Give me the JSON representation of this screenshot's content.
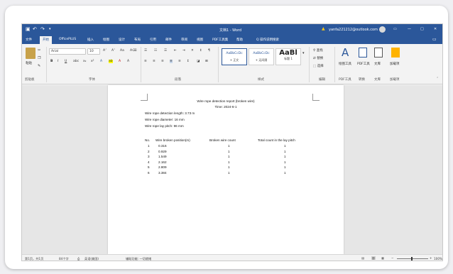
{
  "titlebar": {
    "doc_title": "文档1 - Word",
    "account": "yanfa221212@outlook.com",
    "undo_label": "↶",
    "redo_label": "↷",
    "warn_label": "▲",
    "minimize": "—",
    "restore": "□",
    "close": "✕",
    "ribbon_display": "▭"
  },
  "tabs": [
    "文件",
    "开始",
    "OfficePLUS",
    "插入",
    "绘图",
    "设计",
    "布局",
    "引用",
    "邮件",
    "审阅",
    "视图",
    "PDF工具集",
    "帮助",
    "Q 操作说明搜索"
  ],
  "active_tab": "开始",
  "ribbon": {
    "paste_label": "粘贴",
    "clipboard_label": "剪贴板",
    "font_name": "Arial",
    "font_size": "10",
    "font_label": "字体",
    "paragraph_label": "段落",
    "styles_label": "样式",
    "editing_label": "编辑",
    "styles": [
      {
        "sample": "AaBbCcDc",
        "name": "+ 正文"
      },
      {
        "sample": "AaBbCcDc",
        "name": "+ 无间隔"
      },
      {
        "sample": "AaBl",
        "name": "标题 1"
      }
    ],
    "find_label": "查找",
    "replace_label": "替换",
    "select_label": "选择",
    "draw_label": "绘图工具",
    "pdf_label": "PDF工具",
    "convert_label": "转换",
    "wen_label": "文库",
    "plugin_label": "加载项",
    "font_menu_b": "B",
    "font_menu_i": "I",
    "font_menu_u": "U"
  },
  "document": {
    "title": "Wire rope detection report (broken wire)",
    "time_label": "Time:",
    "time_value": "2024-6-1",
    "length_label": "Wire rope detection length:",
    "length_value": "3.73 m",
    "diameter_label": "Wire rope diameter:",
    "diameter_value": "16 mm",
    "pitch_label": "Wire rope lay pitch:",
    "pitch_value": "96 mm",
    "headers": [
      "No.",
      "Wire broken position(m)",
      "Broken wire count",
      "Total count in the lay pitch"
    ],
    "rows": [
      [
        "1",
        "0.316",
        "1",
        "1"
      ],
      [
        "2",
        "0.929",
        "1",
        "1"
      ],
      [
        "3",
        "1.549",
        "1",
        "1"
      ],
      [
        "4",
        "2.162",
        "1",
        "1"
      ],
      [
        "5",
        "2.809",
        "1",
        "1"
      ],
      [
        "6",
        "3.384",
        "1",
        "1"
      ]
    ]
  },
  "status": {
    "page": "第1页，共1页",
    "words": "84个字",
    "lang": "英语(美国)",
    "accessibility": "辅助功能: 一切就绪",
    "zoom": "100%"
  },
  "colors": {
    "brand": "#2b579a"
  }
}
